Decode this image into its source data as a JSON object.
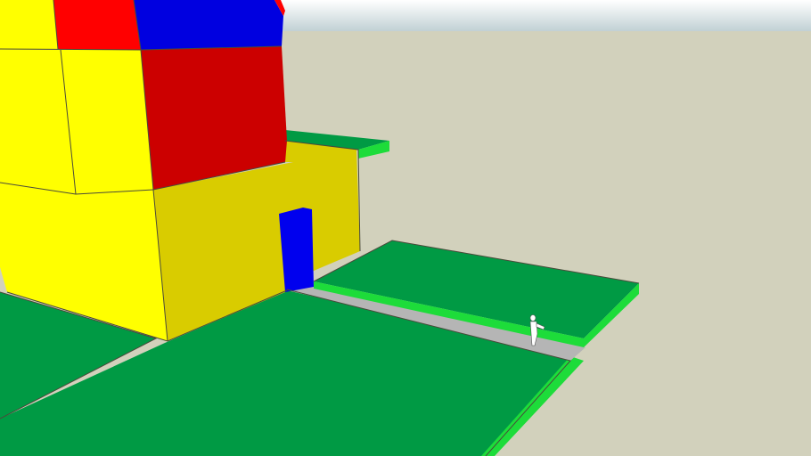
{
  "scene": {
    "colors": {
      "sky_top": "#ffffff",
      "sky_bottom": "#bfcfd3",
      "ground": "#d2d1bc",
      "lawn": "#009a44",
      "lawn_edge": "#1ddc3a",
      "path": "#b5b5b5",
      "wall_yellow": "#ffff00",
      "wall_yellow_shade": "#d9cc00",
      "roof_red": "#ff0000",
      "wall_red": "#cc0000",
      "roof_blue": "#0000e0",
      "door_blue": "#0000ee",
      "figure_white": "#ffffff",
      "edge_dark": "#4a4a3a"
    }
  }
}
